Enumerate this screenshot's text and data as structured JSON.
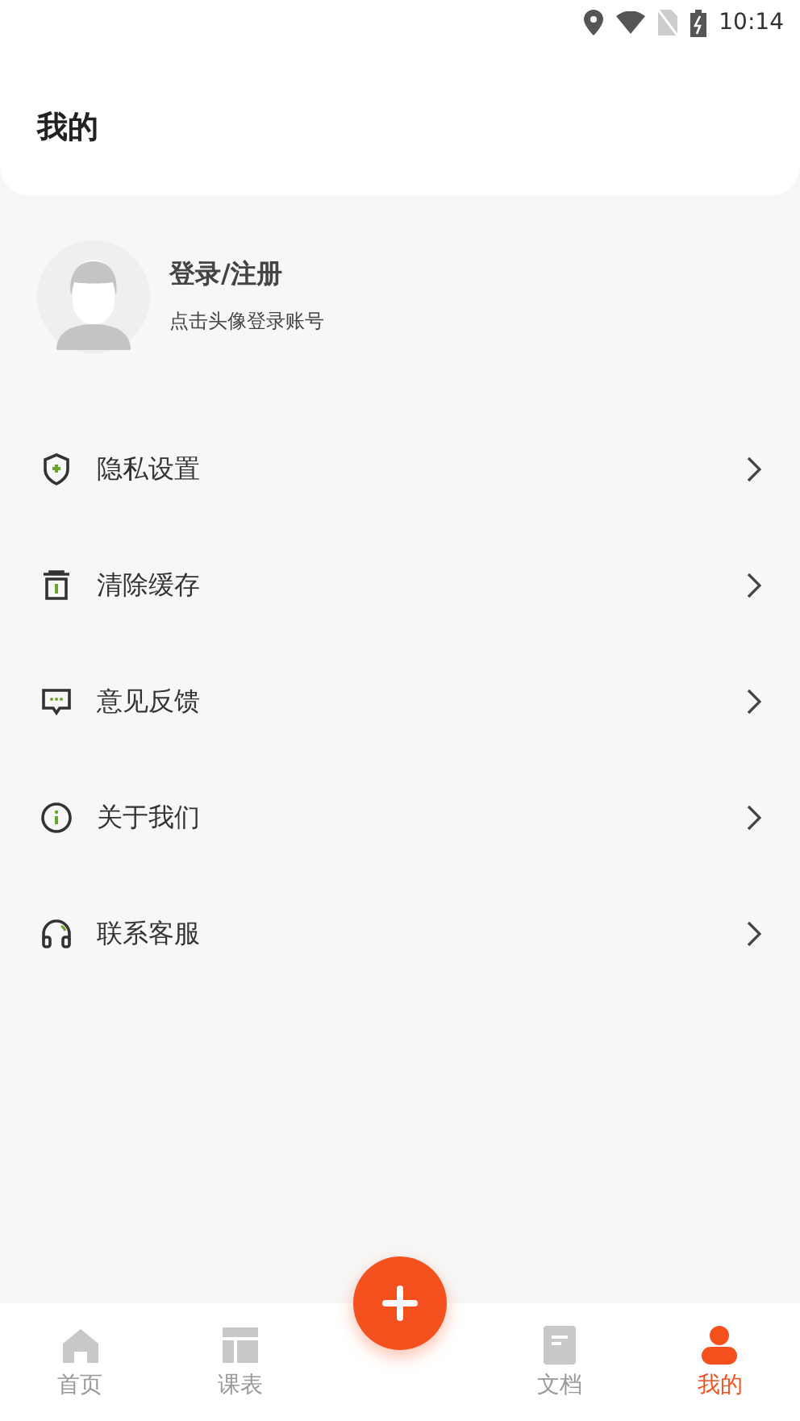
{
  "status_bar": {
    "time": "10:14"
  },
  "header": {
    "title": "我的"
  },
  "profile": {
    "name": "登录/注册",
    "hint": "点击头像登录账号"
  },
  "menu": [
    {
      "kind": "shield",
      "label": "隐私设置"
    },
    {
      "kind": "trash",
      "label": "清除缓存"
    },
    {
      "kind": "chat",
      "label": "意见反馈"
    },
    {
      "kind": "info",
      "label": "关于我们"
    },
    {
      "kind": "headset",
      "label": "联系客服"
    }
  ],
  "tabs": [
    {
      "kind": "home",
      "label": "首页",
      "selected": false
    },
    {
      "kind": "table",
      "label": "课表",
      "selected": false
    },
    {
      "kind": "fab"
    },
    {
      "kind": "doc",
      "label": "文档",
      "selected": false
    },
    {
      "kind": "user",
      "label": "我的",
      "selected": true
    }
  ]
}
